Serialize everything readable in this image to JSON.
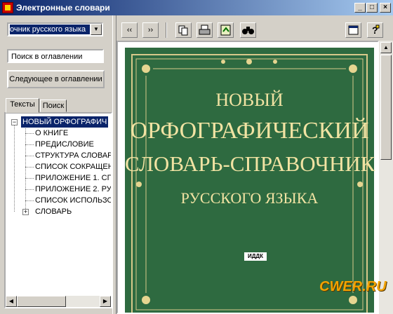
{
  "window": {
    "title": "Электронные словари"
  },
  "caption_buttons": {
    "minimize": "_",
    "maximize": "□",
    "close": "×"
  },
  "dictionary_select": {
    "value": "очник русского языка"
  },
  "contents_search": {
    "value": "Поиск в оглавлении"
  },
  "next_button": {
    "label": "Следующее в оглавлении"
  },
  "tabs": {
    "texts": "Тексты",
    "search": "Поиск"
  },
  "tree": {
    "items": [
      {
        "label": "НОВЫЙ ОРФОГРАФИЧ"
      },
      {
        "label": "О КНИГЕ"
      },
      {
        "label": "ПРЕДИСЛОВИЕ"
      },
      {
        "label": "СТРУКТУРА СЛОВАР"
      },
      {
        "label": "СПИСОК СОКРАЩЕН"
      },
      {
        "label": "ПРИЛОЖЕНИЕ 1. СП"
      },
      {
        "label": "ПРИЛОЖЕНИЕ 2. РУ"
      },
      {
        "label": "СПИСОК ИСПОЛЬЗО"
      },
      {
        "label": "СЛОВАРЬ"
      }
    ]
  },
  "toolbar": {
    "back": "‹‹",
    "forward": "››"
  },
  "cover": {
    "line1": "НОВЫЙ",
    "line2": "ОРФОГРАФИЧЕСКИЙ",
    "line3": "СЛОВАРЬ-СПРАВОЧНИК",
    "line4": "РУССКОГО ЯЗЫКА",
    "publisher": "ИДДК"
  },
  "watermark": {
    "text": "CWER.RU"
  },
  "colors": {
    "selection": "#0a246a",
    "cover_bg": "#2e6a40",
    "cover_text": "#f1e3a3"
  },
  "icons": [
    "app-icon",
    "copy-icon",
    "print-icon",
    "export-icon",
    "binoculars-icon",
    "settings-icon",
    "help-icon"
  ]
}
